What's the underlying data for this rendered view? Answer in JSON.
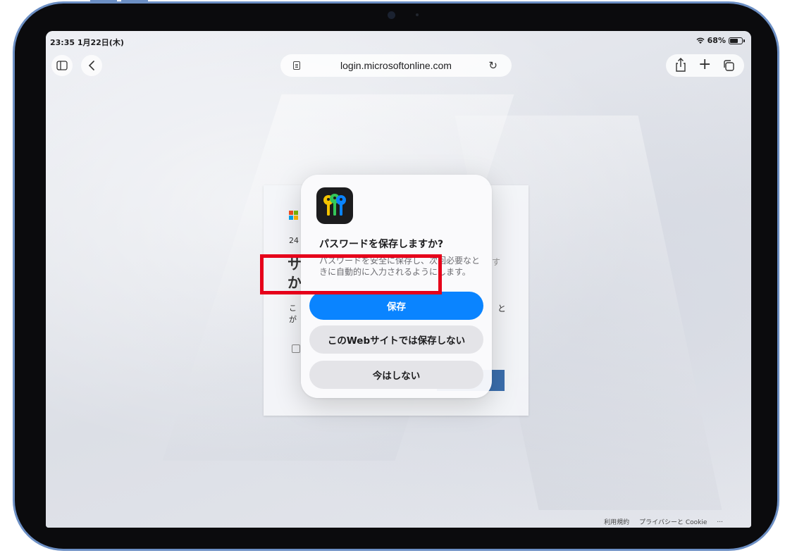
{
  "status_bar": {
    "time_date": "23:35  1月22日(木)",
    "battery": "68%"
  },
  "toolbar": {
    "url": "login.microsoftonline.com"
  },
  "background_page": {
    "line1": "24",
    "line2": "サ",
    "line3": "か",
    "line4": "こ",
    "line5": "が",
    "right_char": "と",
    "right_snip": "す"
  },
  "dialog": {
    "title": "パスワードを保存しますか?",
    "message": "パスワードを安全に保存し、次回必要なときに自動的に入力されるようにします。",
    "save_label": "保存",
    "never_label": "このWebサイトでは保存しない",
    "not_now_label": "今はしない"
  },
  "footer": {
    "terms": "利用規約",
    "privacy": "プライバシーと Cookie",
    "more": "..."
  },
  "colors": {
    "accent": "#0a84ff",
    "highlight": "#e6001a",
    "device_frame": "#6c8fc4"
  }
}
